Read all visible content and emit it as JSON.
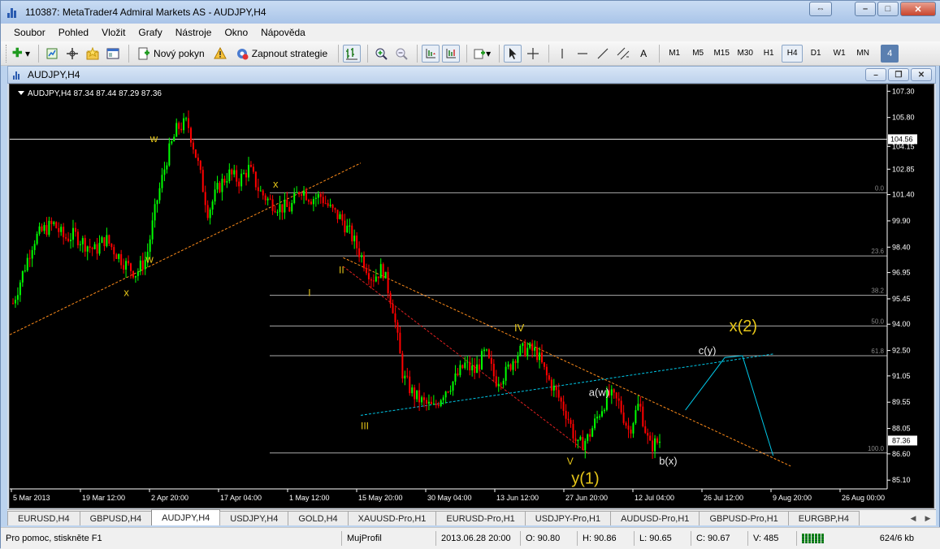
{
  "window": {
    "title": "110387: MetaTrader4 Admiral Markets AS - AUDJPY,H4",
    "buttons": {
      "restore": "⇔",
      "minimize": "–",
      "maximize": "□",
      "close": "✕"
    }
  },
  "menu": [
    "Soubor",
    "Pohled",
    "Vložit",
    "Grafy",
    "Nástroje",
    "Okno",
    "Nápověda"
  ],
  "toolbar": {
    "new_order": "Nový pokyn",
    "strategy": "Zapnout strategie",
    "draw_text": "A",
    "timeframes": [
      "M1",
      "M5",
      "M15",
      "M30",
      "H1",
      "H4",
      "D1",
      "W1",
      "MN"
    ],
    "active_timeframe": "H4",
    "badge": "4"
  },
  "chart_window": {
    "title": "AUDJPY,H4",
    "header": "AUDJPY,H4  87.34 87.44 87.29 87.36"
  },
  "chart_data": {
    "type": "candlestick",
    "symbol": "AUDJPY",
    "timeframe": "H4",
    "ylim": [
      84.6,
      107.5
    ],
    "price_ticks": [
      "107.30",
      "105.80",
      "104.15",
      "102.85",
      "101.40",
      "99.90",
      "98.40",
      "96.95",
      "95.45",
      "94.00",
      "92.50",
      "91.05",
      "89.55",
      "88.05",
      "86.60",
      "85.10"
    ],
    "date_ticks": [
      "5 Mar 2013",
      "19 Mar 12:00",
      "2 Apr 20:00",
      "17 Apr 04:00",
      "1 May 12:00",
      "15 May 20:00",
      "30 May 04:00",
      "13 Jun 12:00",
      "27 Jun 20:00",
      "12 Jul 04:00",
      "26 Jul 12:00",
      "9 Aug 20:00",
      "26 Aug 00:00"
    ],
    "horizontal_line_label": "104.56",
    "current_price_label": "87.36",
    "fibonacci_levels": [
      {
        "label": "0.0",
        "price": 101.5
      },
      {
        "label": "23.6",
        "price": 97.9
      },
      {
        "label": "38.2",
        "price": 95.65
      },
      {
        "label": "50.0",
        "price": 93.9
      },
      {
        "label": "61.8",
        "price": 92.2
      },
      {
        "label": "100.0",
        "price": 86.65
      }
    ],
    "price_path": [
      95.2,
      97.0,
      98.8,
      99.4,
      99.7,
      98.9,
      99.1,
      98.6,
      98.2,
      98.9,
      98.1,
      97.4,
      96.9,
      97.8,
      101.0,
      103.5,
      105.2,
      105.5,
      103.2,
      100.4,
      101.8,
      102.6,
      102.2,
      102.9,
      101.6,
      101.0,
      100.7,
      100.6,
      101.8,
      101.2,
      101.3,
      100.5,
      100.0,
      99.0,
      97.8,
      96.6,
      97.2,
      95.0,
      91.0,
      90.0,
      89.5,
      89.2,
      90.2,
      90.8,
      91.7,
      91.3,
      92.4,
      90.8,
      91.2,
      92.3,
      92.6,
      92.4,
      91.0,
      90.0,
      88.8,
      87.0,
      87.5,
      88.8,
      90.0,
      89.5,
      87.9,
      89.5,
      87.0,
      87.36
    ],
    "wave_labels": [
      {
        "text": "w"
      },
      {
        "text": "w"
      },
      {
        "text": "x"
      },
      {
        "text": "x"
      },
      {
        "text": "I"
      },
      {
        "text": "II"
      },
      {
        "text": "III"
      },
      {
        "text": "IV"
      },
      {
        "text": "V"
      },
      {
        "text": "y(1)"
      },
      {
        "text": "a(w)"
      },
      {
        "text": "b(x)"
      },
      {
        "text": "c(y)"
      },
      {
        "text": "x(2)"
      }
    ]
  },
  "tabs": [
    "EURUSD,H4",
    "GBPUSD,H4",
    "AUDJPY,H4",
    "USDJPY,H4",
    "GOLD,H4",
    "XAUUSD-Pro,H1",
    "EURUSD-Pro,H1",
    "USDJPY-Pro,H1",
    "AUDUSD-Pro,H1",
    "GBPUSD-Pro,H1",
    "EURGBP,H4"
  ],
  "active_tab": "AUDJPY,H4",
  "status": {
    "help": "Pro pomoc, stiskněte F1",
    "profile": "MujProfil",
    "datetime": "2013.06.28 20:00",
    "open": "O: 90.80",
    "high": "H: 90.86",
    "low": "L: 90.65",
    "close": "C: 90.67",
    "volume": "V: 485",
    "traffic": "624/6 kb"
  },
  "colors": {
    "bull": "#00ff00",
    "bear": "#ff0000",
    "wave_label": "#e6c619",
    "projection": "#00c8e8",
    "fib": "#aaaaaa",
    "trend_orange": "#ff8c1a",
    "trend_red": "#e02020"
  }
}
